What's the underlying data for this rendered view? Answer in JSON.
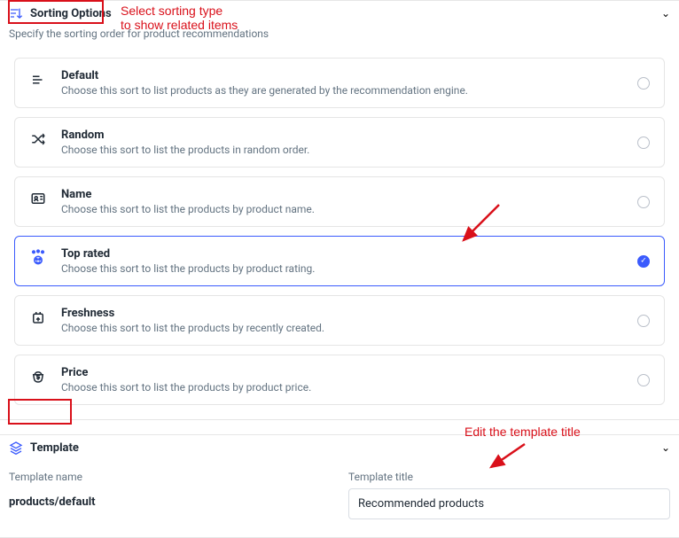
{
  "sorting": {
    "header": "Sorting Options",
    "desc": "Specify the sorting order for product recommendations",
    "options": [
      {
        "title": "Default",
        "desc": "Choose this sort to list products as they are generated by the recommendation engine."
      },
      {
        "title": "Random",
        "desc": "Choose this sort to list the products in random order."
      },
      {
        "title": "Name",
        "desc": "Choose this sort to list the products by product name."
      },
      {
        "title": "Top rated",
        "desc": "Choose this sort to list the products by product rating."
      },
      {
        "title": "Freshness",
        "desc": "Choose this sort to list the products by recently created."
      },
      {
        "title": "Price",
        "desc": "Choose this sort to list the products by product price."
      }
    ],
    "selected_index": 3
  },
  "template": {
    "header": "Template",
    "name_label": "Template name",
    "name_value": "products/default",
    "title_label": "Template title",
    "title_value": "Recommended products"
  },
  "annotations": {
    "select_sort": "Select sorting type\nto show related items",
    "edit_title": "Edit the template title"
  }
}
